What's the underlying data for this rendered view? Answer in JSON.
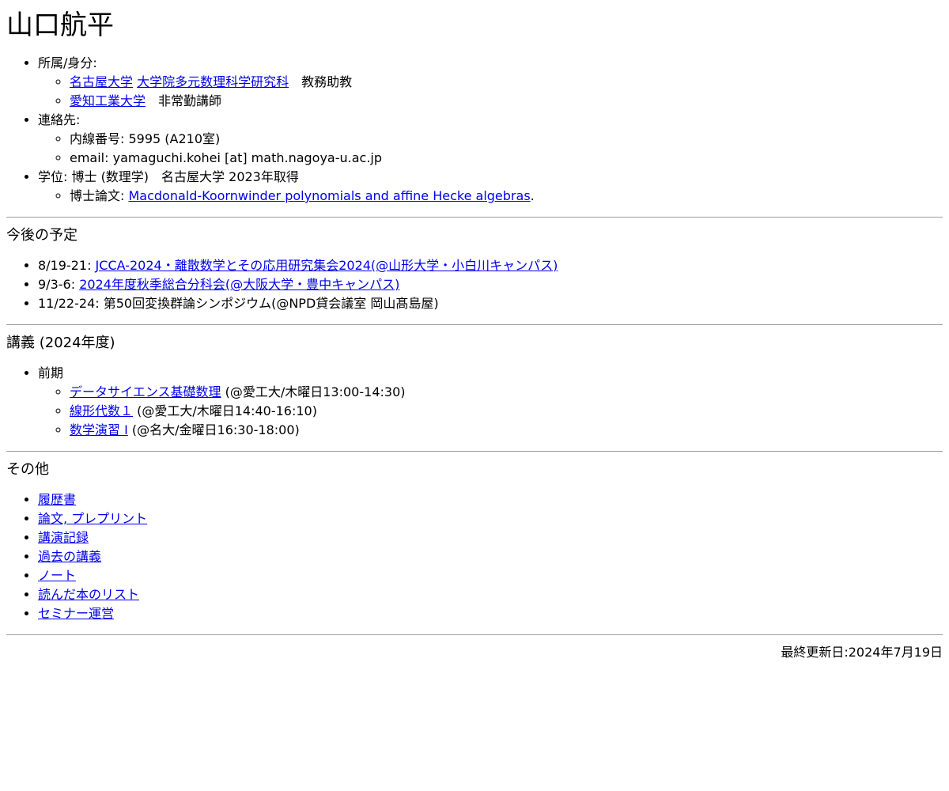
{
  "header": {
    "name": "山口航平"
  },
  "profile": {
    "affiliation_label": "所属/身分:",
    "aff1": {
      "univ": "名古屋大学",
      "dept": "大学院多元数理科学研究科",
      "role": "　教務助教"
    },
    "aff2": {
      "univ": "愛知工業大学",
      "role": "　非常勤講師"
    },
    "contact_label": "連絡先:",
    "extension": "内線番号: 5995 (A210室)",
    "email": "email: yamaguchi.kohei [at] math.nagoya-u.ac.jp",
    "degree": "学位: 博士 (数理学)　名古屋大学 2023年取得",
    "thesis_prefix": "博士論文: ",
    "thesis_title": "Macdonald-Koornwinder polynomials and affine Hecke algebras",
    "thesis_suffix": "."
  },
  "schedule": {
    "heading": "今後の予定",
    "items": [
      {
        "date": "8/19-21: ",
        "event": "JCCA-2024・離散数学とその応用研究集会2024(@山形大学・小白川キャンパス)"
      },
      {
        "date": "9/3-6: ",
        "event": "2024年度秋季総合分科会(@大阪大学・豊中キャンパス)"
      },
      {
        "text": "11/22-24: 第50回変換群論シンポジウム(@NPD貸会議室 岡山髙島屋)"
      }
    ]
  },
  "lectures": {
    "heading": "講義 (2024年度)",
    "term": "前期",
    "items": [
      {
        "title": "データサイエンス基礎数理",
        "detail": " (@愛工大/木曜日13:00-14:30)"
      },
      {
        "title": "線形代数１",
        "detail": " (@愛工大/木曜日14:40-16:10)"
      },
      {
        "title": "数学演習 I",
        "detail": " (@名大/金曜日16:30-18:00)"
      }
    ]
  },
  "others": {
    "heading": "その他",
    "links": [
      "履歴書",
      "論文, プレプリント",
      "講演記録",
      "過去の講義",
      "ノート",
      "読んだ本のリスト",
      "セミナー運営"
    ]
  },
  "footer": {
    "last_updated": "最終更新日:2024年7月19日"
  },
  "colors": {
    "link": "#0000ee",
    "rule": "#9a9a9a",
    "text": "#000000",
    "background": "#ffffff"
  }
}
